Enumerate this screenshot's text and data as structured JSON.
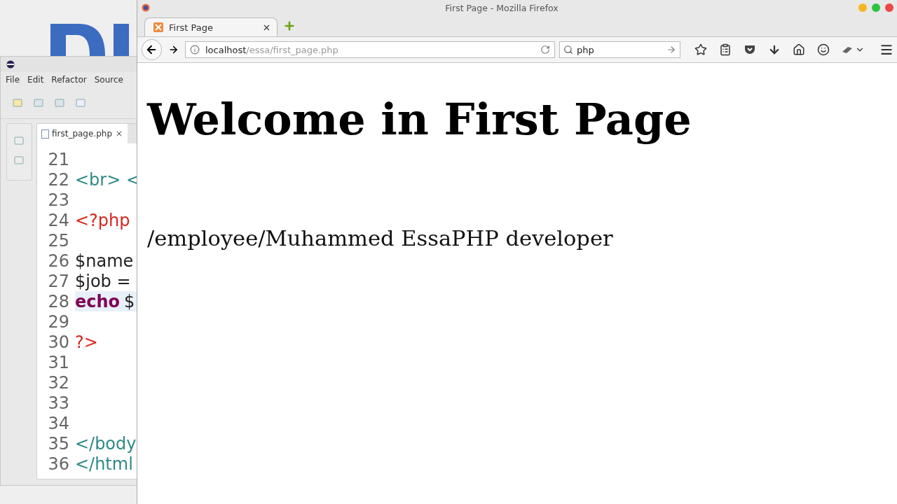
{
  "ide": {
    "menu": [
      {
        "label": "File"
      },
      {
        "label": "Edit"
      },
      {
        "label": "Refactor"
      },
      {
        "label": "Source"
      }
    ],
    "editor_tab": {
      "label": "first_page.php",
      "selected": true
    },
    "lines": [
      {
        "number": "21",
        "current": false
      },
      {
        "number": "22",
        "current": false,
        "tokens": [
          {
            "text": "<br> <",
            "kind": "tag"
          }
        ]
      },
      {
        "number": "23",
        "current": false
      },
      {
        "number": "24",
        "current": false,
        "tokens": [
          {
            "text": "<?php",
            "kind": "php"
          }
        ]
      },
      {
        "number": "25",
        "current": false
      },
      {
        "number": "26",
        "current": false,
        "tokens": [
          {
            "text": "$name",
            "kind": "plain"
          }
        ]
      },
      {
        "number": "27",
        "current": false,
        "tokens": [
          {
            "text": "$job =",
            "kind": "plain"
          }
        ]
      },
      {
        "number": "28",
        "current": true,
        "tokens": [
          {
            "text": "echo",
            "kind": "keyword"
          },
          {
            "text": "$",
            "kind": "plain"
          }
        ]
      },
      {
        "number": "29",
        "current": false
      },
      {
        "number": "30",
        "current": false,
        "tokens": [
          {
            "text": "?>",
            "kind": "php"
          }
        ]
      },
      {
        "number": "31",
        "current": false
      },
      {
        "number": "32",
        "current": false
      },
      {
        "number": "33",
        "current": false
      },
      {
        "number": "34",
        "current": false
      },
      {
        "number": "35",
        "current": false,
        "tokens": [
          {
            "text": "</body",
            "kind": "tag"
          }
        ]
      },
      {
        "number": "36",
        "current": false,
        "tokens": [
          {
            "text": "</html",
            "kind": "tag"
          }
        ]
      }
    ]
  },
  "browser": {
    "title": "First Page - Mozilla Firefox",
    "tabs": [
      {
        "label": "First Page",
        "selected": true
      }
    ],
    "url": {
      "host": "localhost",
      "path": "/essa/first_page.php"
    },
    "search": {
      "value": "php"
    },
    "page": {
      "heading": "Welcome in First Page",
      "paragraph": "/employee/Muhammed EssaPHP developer"
    }
  }
}
